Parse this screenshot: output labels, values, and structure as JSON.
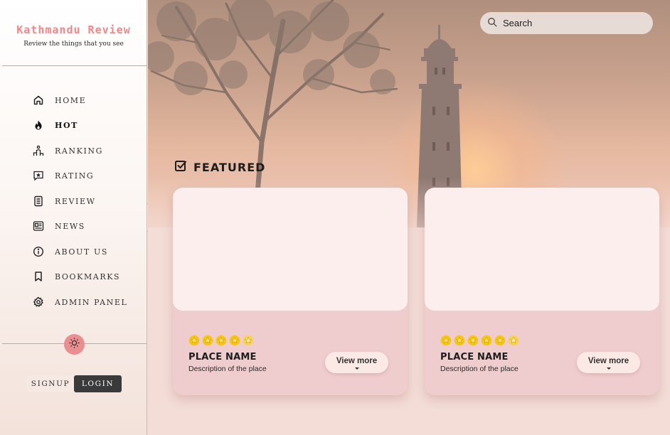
{
  "brand": {
    "title": "Kathmandu Review",
    "tagline": "Review the things that you see"
  },
  "nav": {
    "items": [
      {
        "id": "home",
        "label": "HOME",
        "icon": "home-icon",
        "active": false
      },
      {
        "id": "hot",
        "label": "HOT",
        "icon": "flame-icon",
        "active": true
      },
      {
        "id": "ranking",
        "label": "RANKING",
        "icon": "ranking-icon",
        "active": false
      },
      {
        "id": "rating",
        "label": "RATING",
        "icon": "star-box-icon",
        "active": false
      },
      {
        "id": "review",
        "label": "REVIEW",
        "icon": "document-icon",
        "active": false
      },
      {
        "id": "news",
        "label": "NEWS",
        "icon": "newspaper-icon",
        "active": false
      },
      {
        "id": "about",
        "label": "ABOUT US",
        "icon": "info-icon",
        "active": false
      },
      {
        "id": "bookmarks",
        "label": "BOOKMARKS",
        "icon": "bookmark-icon",
        "active": false
      },
      {
        "id": "admin",
        "label": "ADMIN PANEL",
        "icon": "gear-icon",
        "active": false
      }
    ]
  },
  "auth": {
    "signup_label": "SIGNUP",
    "login_label": "LOGIN"
  },
  "search": {
    "placeholder": "Search"
  },
  "featured": {
    "title": "FEATURED",
    "cards": [
      {
        "name": "PLACE NAME",
        "description": "Description of the place",
        "stars": 4.5,
        "button_label": "View more"
      },
      {
        "name": "PLACE NAME",
        "description": "Description of the place",
        "stars": 4.5,
        "button_label": "View more"
      }
    ]
  },
  "colors": {
    "brand": "#f4868a",
    "toggle": "#e98f92",
    "card": "#efcccd",
    "card_image": "#fdeeee",
    "star": "#f5c518",
    "login_bg": "#3a3a3a"
  }
}
